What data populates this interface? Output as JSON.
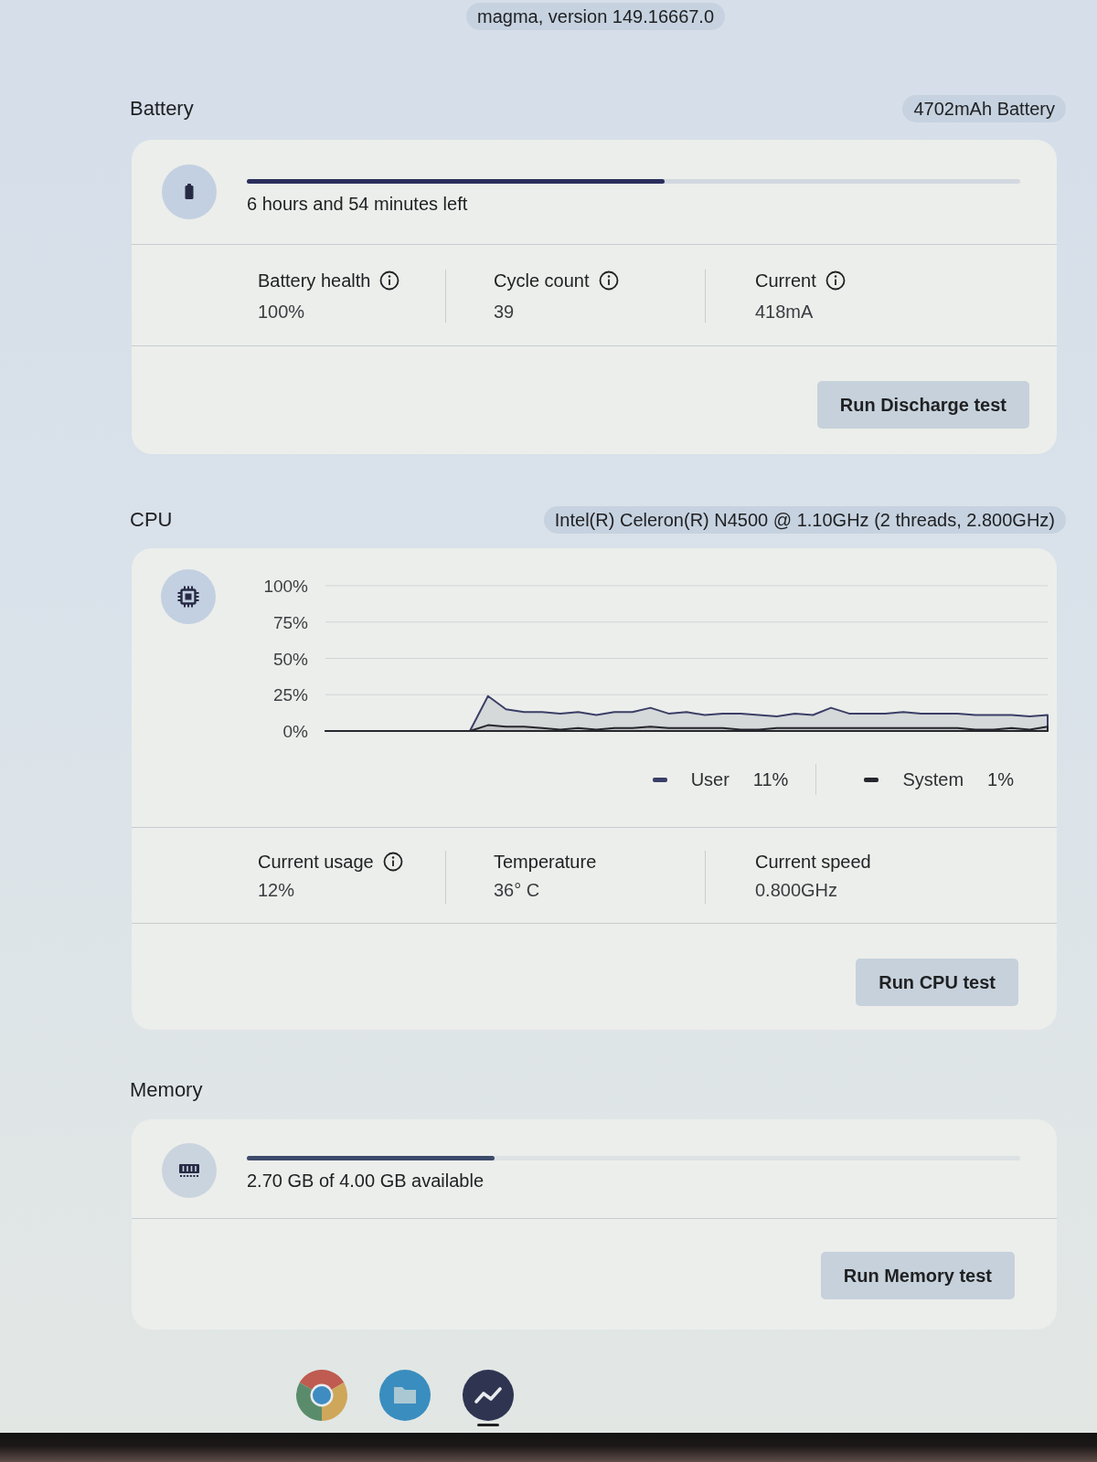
{
  "version_chip": "magma, version 149.16667.0",
  "battery": {
    "title": "Battery",
    "badge": "4702mAh Battery",
    "level": 0.54,
    "status": "6 hours and 54 minutes left",
    "metrics": [
      {
        "label": "Battery health",
        "info": true,
        "value": "100%"
      },
      {
        "label": "Cycle count",
        "info": true,
        "value": "39"
      },
      {
        "label": "Current",
        "info": true,
        "value": "418mA"
      }
    ],
    "button": "Run Discharge test"
  },
  "cpu": {
    "title": "CPU",
    "badge": "Intel(R) Celeron(R) N4500 @ 1.10GHz (2 threads, 2.800GHz)",
    "chart_data": {
      "type": "area",
      "categories": [
        null,
        null,
        null,
        null,
        null,
        null,
        null,
        null,
        null,
        null,
        null,
        null,
        null,
        null,
        null,
        null,
        null,
        null,
        null,
        null,
        null,
        null,
        null,
        null,
        null,
        null,
        null,
        null,
        null,
        null,
        null,
        null,
        null,
        null,
        null,
        null,
        null,
        null,
        null,
        null,
        null
      ],
      "ylim": [
        0,
        100
      ],
      "yticks": [
        {
          "value": 0,
          "label": "0%"
        },
        {
          "value": 25,
          "label": "25%"
        },
        {
          "value": 50,
          "label": "50%"
        },
        {
          "value": 75,
          "label": "75%"
        },
        {
          "value": 100,
          "label": "100%"
        }
      ],
      "grid": true,
      "stacked": false,
      "series": [
        {
          "name": "User",
          "color": "#3b3f66",
          "values": [
            0,
            0,
            0,
            0,
            0,
            0,
            0,
            0,
            0,
            24,
            15,
            13,
            13,
            12,
            13,
            11,
            13,
            13,
            16,
            12,
            13,
            11,
            12,
            12,
            11,
            10,
            12,
            11,
            16,
            12,
            12,
            12,
            13,
            12,
            12,
            12,
            11,
            11,
            11,
            10,
            11
          ]
        },
        {
          "name": "System",
          "color": "#26272d",
          "values": [
            0,
            0,
            0,
            0,
            0,
            0,
            0,
            0,
            0,
            4,
            3,
            3,
            2,
            1,
            2,
            1,
            2,
            2,
            3,
            2,
            2,
            2,
            2,
            1,
            1,
            2,
            2,
            2,
            2,
            2,
            2,
            2,
            2,
            2,
            2,
            2,
            1,
            1,
            2,
            1,
            3
          ]
        }
      ]
    },
    "legend": [
      {
        "value": "11%"
      },
      {
        "value": "1%"
      }
    ],
    "metrics": [
      {
        "label": "Current usage",
        "info": true,
        "value": "12%"
      },
      {
        "label": "Temperature",
        "info": false,
        "value": "36° C"
      },
      {
        "label": "Current speed",
        "info": false,
        "value": "0.800GHz"
      }
    ],
    "button": "Run CPU test"
  },
  "memory": {
    "title": "Memory",
    "level": 0.32,
    "status": "2.70 GB of 4.00 GB available",
    "button": "Run Memory test"
  },
  "shelf": {
    "apps": [
      {
        "kind": "browser",
        "active": false
      },
      {
        "kind": "files",
        "active": false
      },
      {
        "kind": "diagnostics",
        "active": true
      }
    ]
  }
}
